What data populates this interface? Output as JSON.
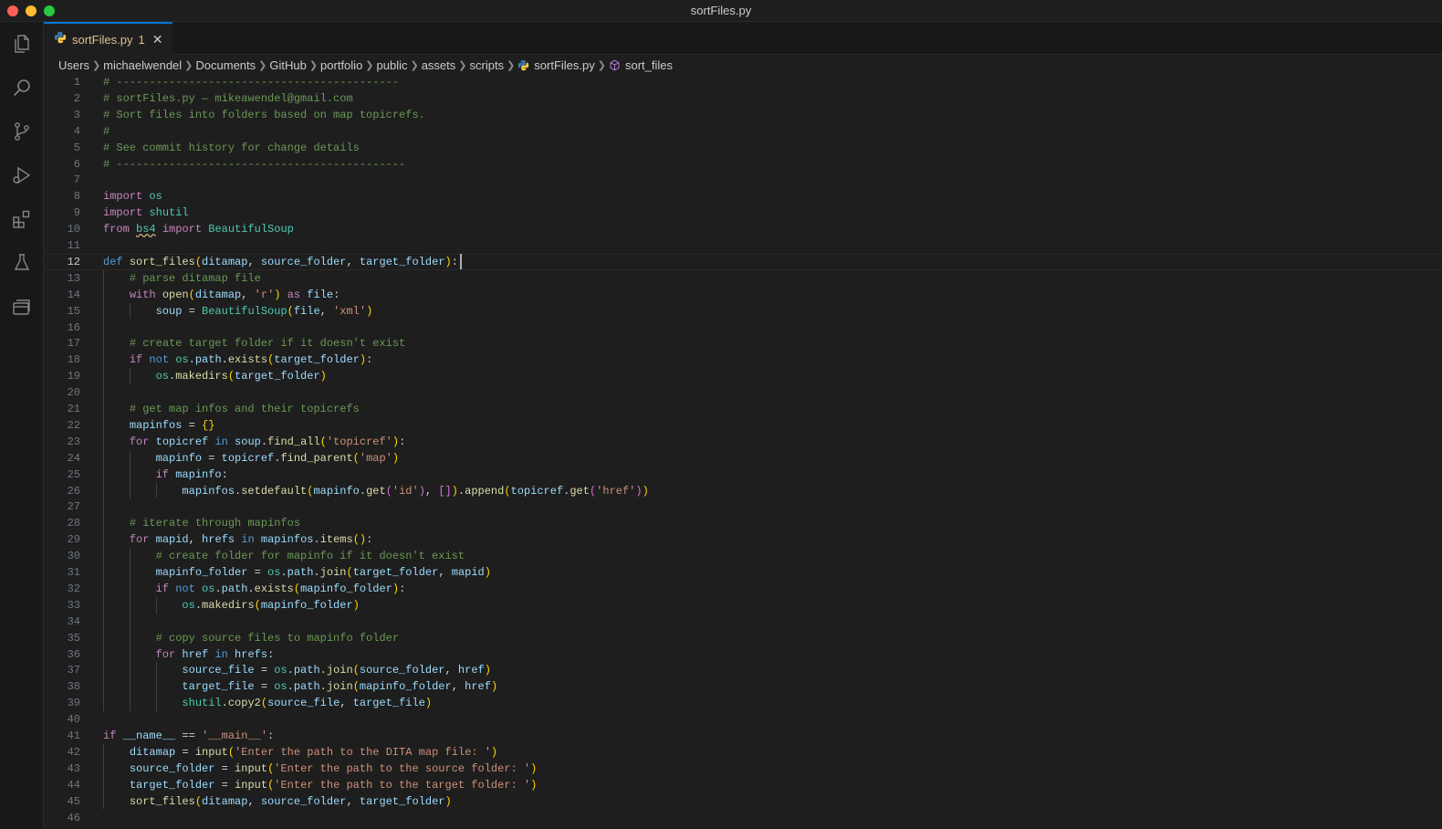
{
  "window": {
    "title": "sortFiles.py"
  },
  "activity_bar": [
    "explorer-icon",
    "search-icon",
    "source-control-icon",
    "run-debug-icon",
    "extensions-icon",
    "testing-icon",
    "remote-explorer-icon"
  ],
  "tab": {
    "label": "sortFiles.py",
    "badge": "1",
    "close": "✕"
  },
  "breadcrumb": [
    "Users",
    "michaelwendel",
    "Documents",
    "GitHub",
    "portfolio",
    "public",
    "assets",
    "scripts",
    "sortFiles.py",
    "sort_files"
  ],
  "editor": {
    "active_line": 12,
    "lines": [
      [
        [
          "c",
          "# -------------------------------------------"
        ]
      ],
      [
        [
          "c",
          "# sortFiles.py — mikeawendel@gmail.com"
        ]
      ],
      [
        [
          "c",
          "# Sort files into folders based on map topicrefs."
        ]
      ],
      [
        [
          "c",
          "#"
        ]
      ],
      [
        [
          "c",
          "# See commit history for change details"
        ]
      ],
      [
        [
          "c",
          "# --------------------------------------------"
        ]
      ],
      [],
      [
        [
          "k",
          "import"
        ],
        [
          "p",
          " "
        ],
        [
          "cl",
          "os"
        ]
      ],
      [
        [
          "k",
          "import"
        ],
        [
          "p",
          " "
        ],
        [
          "cl",
          "shutil"
        ]
      ],
      [
        [
          "k",
          "from"
        ],
        [
          "p",
          " "
        ],
        [
          "cl",
          "bs4"
        ],
        [
          "p",
          " "
        ],
        [
          "k",
          "import"
        ],
        [
          "p",
          " "
        ],
        [
          "cl",
          "BeautifulSoup"
        ]
      ],
      [],
      [
        [
          "kb",
          "def"
        ],
        [
          "p",
          " "
        ],
        [
          "f",
          "sort_files"
        ],
        [
          "b1",
          "("
        ],
        [
          "v",
          "ditamap"
        ],
        [
          "p",
          ", "
        ],
        [
          "v",
          "source_folder"
        ],
        [
          "p",
          ", "
        ],
        [
          "v",
          "target_folder"
        ],
        [
          "b1",
          ")"
        ],
        [
          "p",
          ":"
        ]
      ],
      [
        [
          "p",
          "    "
        ],
        [
          "c",
          "# parse ditamap file"
        ]
      ],
      [
        [
          "p",
          "    "
        ],
        [
          "k",
          "with"
        ],
        [
          "p",
          " "
        ],
        [
          "f",
          "open"
        ],
        [
          "b1",
          "("
        ],
        [
          "v",
          "ditamap"
        ],
        [
          "p",
          ", "
        ],
        [
          "s",
          "'r'"
        ],
        [
          "b1",
          ")"
        ],
        [
          "p",
          " "
        ],
        [
          "k",
          "as"
        ],
        [
          "p",
          " "
        ],
        [
          "v",
          "file"
        ],
        [
          "p",
          ":"
        ]
      ],
      [
        [
          "p",
          "        "
        ],
        [
          "v",
          "soup"
        ],
        [
          "p",
          " = "
        ],
        [
          "cl",
          "BeautifulSoup"
        ],
        [
          "b1",
          "("
        ],
        [
          "v",
          "file"
        ],
        [
          "p",
          ", "
        ],
        [
          "s",
          "'xml'"
        ],
        [
          "b1",
          ")"
        ]
      ],
      [],
      [
        [
          "p",
          "    "
        ],
        [
          "c",
          "# create target folder if it doesn't exist"
        ]
      ],
      [
        [
          "p",
          "    "
        ],
        [
          "k",
          "if"
        ],
        [
          "p",
          " "
        ],
        [
          "kb",
          "not"
        ],
        [
          "p",
          " "
        ],
        [
          "cl",
          "os"
        ],
        [
          "p",
          "."
        ],
        [
          "v",
          "path"
        ],
        [
          "p",
          "."
        ],
        [
          "f",
          "exists"
        ],
        [
          "b1",
          "("
        ],
        [
          "v",
          "target_folder"
        ],
        [
          "b1",
          ")"
        ],
        [
          "p",
          ":"
        ]
      ],
      [
        [
          "p",
          "        "
        ],
        [
          "cl",
          "os"
        ],
        [
          "p",
          "."
        ],
        [
          "f",
          "makedirs"
        ],
        [
          "b1",
          "("
        ],
        [
          "v",
          "target_folder"
        ],
        [
          "b1",
          ")"
        ]
      ],
      [],
      [
        [
          "p",
          "    "
        ],
        [
          "c",
          "# get map infos and their topicrefs"
        ]
      ],
      [
        [
          "p",
          "    "
        ],
        [
          "v",
          "mapinfos"
        ],
        [
          "p",
          " = "
        ],
        [
          "b1",
          "{}"
        ]
      ],
      [
        [
          "p",
          "    "
        ],
        [
          "k",
          "for"
        ],
        [
          "p",
          " "
        ],
        [
          "v",
          "topicref"
        ],
        [
          "p",
          " "
        ],
        [
          "kb",
          "in"
        ],
        [
          "p",
          " "
        ],
        [
          "v",
          "soup"
        ],
        [
          "p",
          "."
        ],
        [
          "f",
          "find_all"
        ],
        [
          "b1",
          "("
        ],
        [
          "s",
          "'topicref'"
        ],
        [
          "b1",
          ")"
        ],
        [
          "p",
          ":"
        ]
      ],
      [
        [
          "p",
          "        "
        ],
        [
          "v",
          "mapinfo"
        ],
        [
          "p",
          " = "
        ],
        [
          "v",
          "topicref"
        ],
        [
          "p",
          "."
        ],
        [
          "f",
          "find_parent"
        ],
        [
          "b1",
          "("
        ],
        [
          "s",
          "'map'"
        ],
        [
          "b1",
          ")"
        ]
      ],
      [
        [
          "p",
          "        "
        ],
        [
          "k",
          "if"
        ],
        [
          "p",
          " "
        ],
        [
          "v",
          "mapinfo"
        ],
        [
          "p",
          ":"
        ]
      ],
      [
        [
          "p",
          "            "
        ],
        [
          "v",
          "mapinfos"
        ],
        [
          "p",
          "."
        ],
        [
          "f",
          "setdefault"
        ],
        [
          "b1",
          "("
        ],
        [
          "v",
          "mapinfo"
        ],
        [
          "p",
          "."
        ],
        [
          "f",
          "get"
        ],
        [
          "b2",
          "("
        ],
        [
          "s",
          "'id'"
        ],
        [
          "b2",
          ")"
        ],
        [
          "p",
          ", "
        ],
        [
          "b2",
          "[]"
        ],
        [
          "b1",
          ")"
        ],
        [
          "p",
          "."
        ],
        [
          "f",
          "append"
        ],
        [
          "b1",
          "("
        ],
        [
          "v",
          "topicref"
        ],
        [
          "p",
          "."
        ],
        [
          "f",
          "get"
        ],
        [
          "b2",
          "("
        ],
        [
          "s",
          "'href'"
        ],
        [
          "b2",
          ")"
        ],
        [
          "b1",
          ")"
        ]
      ],
      [],
      [
        [
          "p",
          "    "
        ],
        [
          "c",
          "# iterate through mapinfos"
        ]
      ],
      [
        [
          "p",
          "    "
        ],
        [
          "k",
          "for"
        ],
        [
          "p",
          " "
        ],
        [
          "v",
          "mapid"
        ],
        [
          "p",
          ", "
        ],
        [
          "v",
          "hrefs"
        ],
        [
          "p",
          " "
        ],
        [
          "kb",
          "in"
        ],
        [
          "p",
          " "
        ],
        [
          "v",
          "mapinfos"
        ],
        [
          "p",
          "."
        ],
        [
          "f",
          "items"
        ],
        [
          "b1",
          "()"
        ],
        [
          "p",
          ":"
        ]
      ],
      [
        [
          "p",
          "        "
        ],
        [
          "c",
          "# create folder for mapinfo if it doesn't exist"
        ]
      ],
      [
        [
          "p",
          "        "
        ],
        [
          "v",
          "mapinfo_folder"
        ],
        [
          "p",
          " = "
        ],
        [
          "cl",
          "os"
        ],
        [
          "p",
          "."
        ],
        [
          "v",
          "path"
        ],
        [
          "p",
          "."
        ],
        [
          "f",
          "join"
        ],
        [
          "b1",
          "("
        ],
        [
          "v",
          "target_folder"
        ],
        [
          "p",
          ", "
        ],
        [
          "v",
          "mapid"
        ],
        [
          "b1",
          ")"
        ]
      ],
      [
        [
          "p",
          "        "
        ],
        [
          "k",
          "if"
        ],
        [
          "p",
          " "
        ],
        [
          "kb",
          "not"
        ],
        [
          "p",
          " "
        ],
        [
          "cl",
          "os"
        ],
        [
          "p",
          "."
        ],
        [
          "v",
          "path"
        ],
        [
          "p",
          "."
        ],
        [
          "f",
          "exists"
        ],
        [
          "b1",
          "("
        ],
        [
          "v",
          "mapinfo_folder"
        ],
        [
          "b1",
          ")"
        ],
        [
          "p",
          ":"
        ]
      ],
      [
        [
          "p",
          "            "
        ],
        [
          "cl",
          "os"
        ],
        [
          "p",
          "."
        ],
        [
          "f",
          "makedirs"
        ],
        [
          "b1",
          "("
        ],
        [
          "v",
          "mapinfo_folder"
        ],
        [
          "b1",
          ")"
        ]
      ],
      [],
      [
        [
          "p",
          "        "
        ],
        [
          "c",
          "# copy source files to mapinfo folder"
        ]
      ],
      [
        [
          "p",
          "        "
        ],
        [
          "k",
          "for"
        ],
        [
          "p",
          " "
        ],
        [
          "v",
          "href"
        ],
        [
          "p",
          " "
        ],
        [
          "kb",
          "in"
        ],
        [
          "p",
          " "
        ],
        [
          "v",
          "hrefs"
        ],
        [
          "p",
          ":"
        ]
      ],
      [
        [
          "p",
          "            "
        ],
        [
          "v",
          "source_file"
        ],
        [
          "p",
          " = "
        ],
        [
          "cl",
          "os"
        ],
        [
          "p",
          "."
        ],
        [
          "v",
          "path"
        ],
        [
          "p",
          "."
        ],
        [
          "f",
          "join"
        ],
        [
          "b1",
          "("
        ],
        [
          "v",
          "source_folder"
        ],
        [
          "p",
          ", "
        ],
        [
          "v",
          "href"
        ],
        [
          "b1",
          ")"
        ]
      ],
      [
        [
          "p",
          "            "
        ],
        [
          "v",
          "target_file"
        ],
        [
          "p",
          " = "
        ],
        [
          "cl",
          "os"
        ],
        [
          "p",
          "."
        ],
        [
          "v",
          "path"
        ],
        [
          "p",
          "."
        ],
        [
          "f",
          "join"
        ],
        [
          "b1",
          "("
        ],
        [
          "v",
          "mapinfo_folder"
        ],
        [
          "p",
          ", "
        ],
        [
          "v",
          "href"
        ],
        [
          "b1",
          ")"
        ]
      ],
      [
        [
          "p",
          "            "
        ],
        [
          "cl",
          "shutil"
        ],
        [
          "p",
          "."
        ],
        [
          "f",
          "copy2"
        ],
        [
          "b1",
          "("
        ],
        [
          "v",
          "source_file"
        ],
        [
          "p",
          ", "
        ],
        [
          "v",
          "target_file"
        ],
        [
          "b1",
          ")"
        ]
      ],
      [],
      [
        [
          "k",
          "if"
        ],
        [
          "p",
          " "
        ],
        [
          "v",
          "__name__"
        ],
        [
          "p",
          " == "
        ],
        [
          "s",
          "'__main__'"
        ],
        [
          "p",
          ":"
        ]
      ],
      [
        [
          "p",
          "    "
        ],
        [
          "v",
          "ditamap"
        ],
        [
          "p",
          " = "
        ],
        [
          "f",
          "input"
        ],
        [
          "b1",
          "("
        ],
        [
          "s",
          "'Enter the path to the DITA map file: '"
        ],
        [
          "b1",
          ")"
        ]
      ],
      [
        [
          "p",
          "    "
        ],
        [
          "v",
          "source_folder"
        ],
        [
          "p",
          " = "
        ],
        [
          "f",
          "input"
        ],
        [
          "b1",
          "("
        ],
        [
          "s",
          "'Enter the path to the source folder: '"
        ],
        [
          "b1",
          ")"
        ]
      ],
      [
        [
          "p",
          "    "
        ],
        [
          "v",
          "target_folder"
        ],
        [
          "p",
          " = "
        ],
        [
          "f",
          "input"
        ],
        [
          "b1",
          "("
        ],
        [
          "s",
          "'Enter the path to the target folder: '"
        ],
        [
          "b1",
          ")"
        ]
      ],
      [
        [
          "p",
          "    "
        ],
        [
          "f",
          "sort_files"
        ],
        [
          "b1",
          "("
        ],
        [
          "v",
          "ditamap"
        ],
        [
          "p",
          ", "
        ],
        [
          "v",
          "source_folder"
        ],
        [
          "p",
          ", "
        ],
        [
          "v",
          "target_folder"
        ],
        [
          "b1",
          ")"
        ]
      ],
      []
    ]
  }
}
